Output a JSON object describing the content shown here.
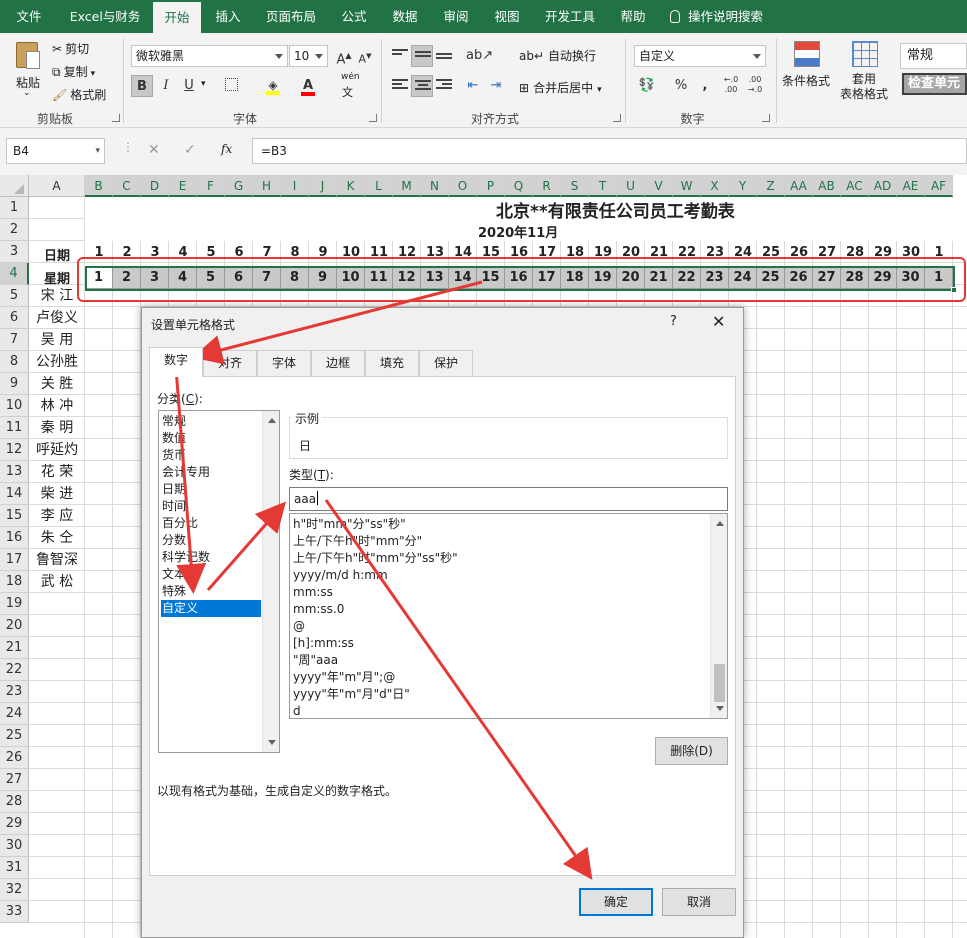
{
  "ribbon_tabs": [
    "文件",
    "Excel与财务",
    "开始",
    "插入",
    "页面布局",
    "公式",
    "数据",
    "审阅",
    "视图",
    "开发工具",
    "帮助",
    "操作说明搜索"
  ],
  "active_tab": "开始",
  "clipboard": {
    "paste": "粘贴",
    "cut": "剪切",
    "copy": "复制",
    "format_painter": "格式刷",
    "label": "剪贴板"
  },
  "font": {
    "name": "微软雅黑",
    "size": "10",
    "bold": "B",
    "italic": "I",
    "underline": "U",
    "phonetic": "wén",
    "label": "字体"
  },
  "alignment": {
    "wrap": "自动换行",
    "merge": "合并后居中",
    "label": "对齐方式"
  },
  "number": {
    "format": "自定义",
    "percent": "%",
    "comma": ",",
    "inc_decimal": "←.0 .00",
    "dec_decimal": ".00 →.0",
    "label": "数字"
  },
  "styles": {
    "conditional": "条件格式",
    "table": "套用\n表格格式",
    "normal": "常规",
    "check_cell": "检查单元"
  },
  "formula_bar": {
    "name_box": "B4",
    "cancel": "✕",
    "enter": "✓",
    "fx": "fx",
    "formula": "=B3"
  },
  "columns": [
    "A",
    "B",
    "C",
    "D",
    "E",
    "F",
    "G",
    "H",
    "I",
    "J",
    "K",
    "L",
    "M",
    "N",
    "O",
    "P",
    "Q",
    "R",
    "S",
    "T",
    "U",
    "V",
    "W",
    "X",
    "Y",
    "Z",
    "AA",
    "AB",
    "AC",
    "AD",
    "AE",
    "AF"
  ],
  "rows": [
    "1",
    "2",
    "3",
    "4",
    "5",
    "6",
    "7",
    "8",
    "9",
    "10",
    "11",
    "12",
    "13",
    "14",
    "15",
    "16",
    "17",
    "18",
    "19",
    "20",
    "21",
    "22",
    "23",
    "24",
    "25",
    "26",
    "27",
    "28",
    "29",
    "30",
    "31",
    "32",
    "33"
  ],
  "sheet": {
    "title": "北京**有限责任公司员工考勤表",
    "month": "2020年11月",
    "date_label": "日期",
    "weekday_label": "星期",
    "days": [
      "1",
      "2",
      "3",
      "4",
      "5",
      "6",
      "7",
      "8",
      "9",
      "10",
      "11",
      "12",
      "13",
      "14",
      "15",
      "16",
      "17",
      "18",
      "19",
      "20",
      "21",
      "22",
      "23",
      "24",
      "25",
      "26",
      "27",
      "28",
      "29",
      "30",
      "1"
    ],
    "weekdays": [
      "1",
      "2",
      "3",
      "4",
      "5",
      "6",
      "7",
      "8",
      "9",
      "10",
      "11",
      "12",
      "13",
      "14",
      "15",
      "16",
      "17",
      "18",
      "19",
      "20",
      "21",
      "22",
      "23",
      "24",
      "25",
      "26",
      "27",
      "28",
      "29",
      "30",
      "1"
    ],
    "employees": [
      "宋 江",
      "卢俊义",
      "吴 用",
      "公孙胜",
      "关 胜",
      "林 冲",
      "秦 明",
      "呼延灼",
      "花 荣",
      "柴 进",
      "李 应",
      "朱 仝",
      "鲁智深",
      "武 松"
    ]
  },
  "dialog": {
    "title": "设置单元格格式",
    "help": "?",
    "close": "✕",
    "tabs": [
      "数字",
      "对齐",
      "字体",
      "边框",
      "填充",
      "保护"
    ],
    "active_tab": "数字",
    "category_label": "分类(C):",
    "categories": [
      "常规",
      "数值",
      "货币",
      "会计专用",
      "日期",
      "时间",
      "百分比",
      "分数",
      "科学记数",
      "文本",
      "特殊",
      "自定义"
    ],
    "selected_category": "自定义",
    "sample_label": "示例",
    "sample_value": "日",
    "type_label": "类型(T):",
    "type_value": "aaa",
    "type_list": [
      "h\"时\"mm\"分\"ss\"秒\"",
      "上午/下午h\"时\"mm\"分\"",
      "上午/下午h\"时\"mm\"分\"ss\"秒\"",
      "yyyy/m/d h:mm",
      "mm:ss",
      "mm:ss.0",
      "@",
      "[h]:mm:ss",
      "\"周\"aaa",
      "yyyy\"年\"m\"月\";@",
      "yyyy\"年\"m\"月\"d\"日\"",
      "d"
    ],
    "delete_button": "删除(D)",
    "description": "以现有格式为基础，生成自定义的数字格式。",
    "ok": "确定",
    "cancel": "取消"
  },
  "colors": {
    "excel_green": "#217346",
    "annotation_red": "#e53935",
    "selection_blue": "#0078d7"
  }
}
